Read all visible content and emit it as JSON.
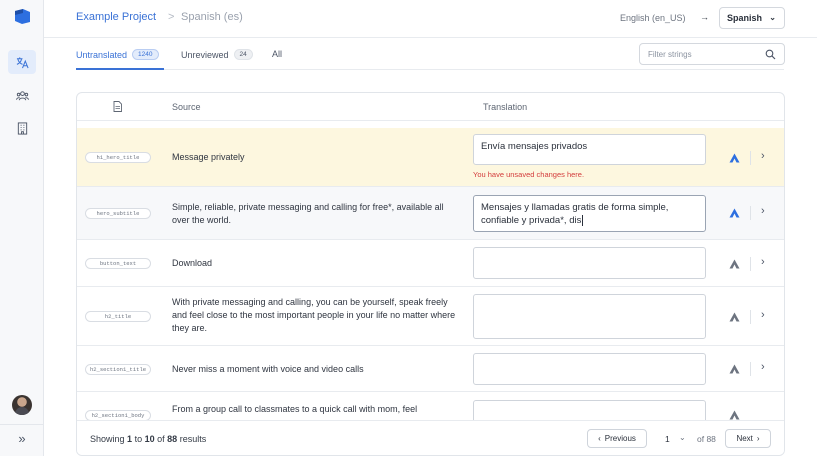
{
  "header": {
    "project": "Example Project",
    "separator": ">",
    "target_locale": "Spanish (es)",
    "source_locale": "English (en_US)",
    "arrow": "→",
    "language_select": "Spanish"
  },
  "tabs": [
    {
      "label": "Untranslated",
      "count": "1240",
      "active": true
    },
    {
      "label": "Unreviewed",
      "count": "24",
      "active": false
    },
    {
      "label": "All",
      "count": null,
      "active": false
    }
  ],
  "filter": {
    "placeholder": "Filter strings"
  },
  "table": {
    "col_source": "Source",
    "col_translation": "Translation"
  },
  "rows": [
    {
      "key": "h1_hero_title",
      "source": "Message privately",
      "translation": "Envía mensajes privados",
      "warning": "You have unsaved changes here.",
      "state": "unsaved"
    },
    {
      "key": "hero_subtitle",
      "source": "Simple, reliable, private messaging and calling for free*, available all over the world.",
      "translation": "Mensajes y llamadas gratis de forma simple, confiable y privada*, dis",
      "state": "editing"
    },
    {
      "key": "button_text",
      "source": "Download",
      "translation": "",
      "state": "empty"
    },
    {
      "key": "h2_title",
      "source": "With private messaging and calling, you can be yourself, speak freely and feel close to the most important people in your life no matter where they are.",
      "translation": "",
      "state": "empty"
    },
    {
      "key": "h2_section1_title",
      "source": "Never miss a moment with voice and video calls",
      "translation": "",
      "state": "empty"
    },
    {
      "key": "h2_section1_body",
      "source": "From a group call to classmates to a quick call with mom, feel",
      "translation": "",
      "state": "empty"
    }
  ],
  "footer": {
    "showing_prefix": "Showing",
    "from": "1",
    "to_word": "to",
    "to": "10",
    "of_word": "of",
    "total": "88",
    "results_word": "results",
    "previous": "Previous",
    "page": "1",
    "of_pages": "of 88",
    "next": "Next"
  },
  "colors": {
    "accent": "#3a72d6",
    "unsaved_bg": "#fdf7df",
    "warning": "#d33c3c"
  },
  "icons": {
    "sidebar": [
      "logo-icon",
      "translate-icon",
      "team-icon",
      "building-icon"
    ],
    "search": "search-icon",
    "machine_translation": "machine-translation-icon"
  }
}
